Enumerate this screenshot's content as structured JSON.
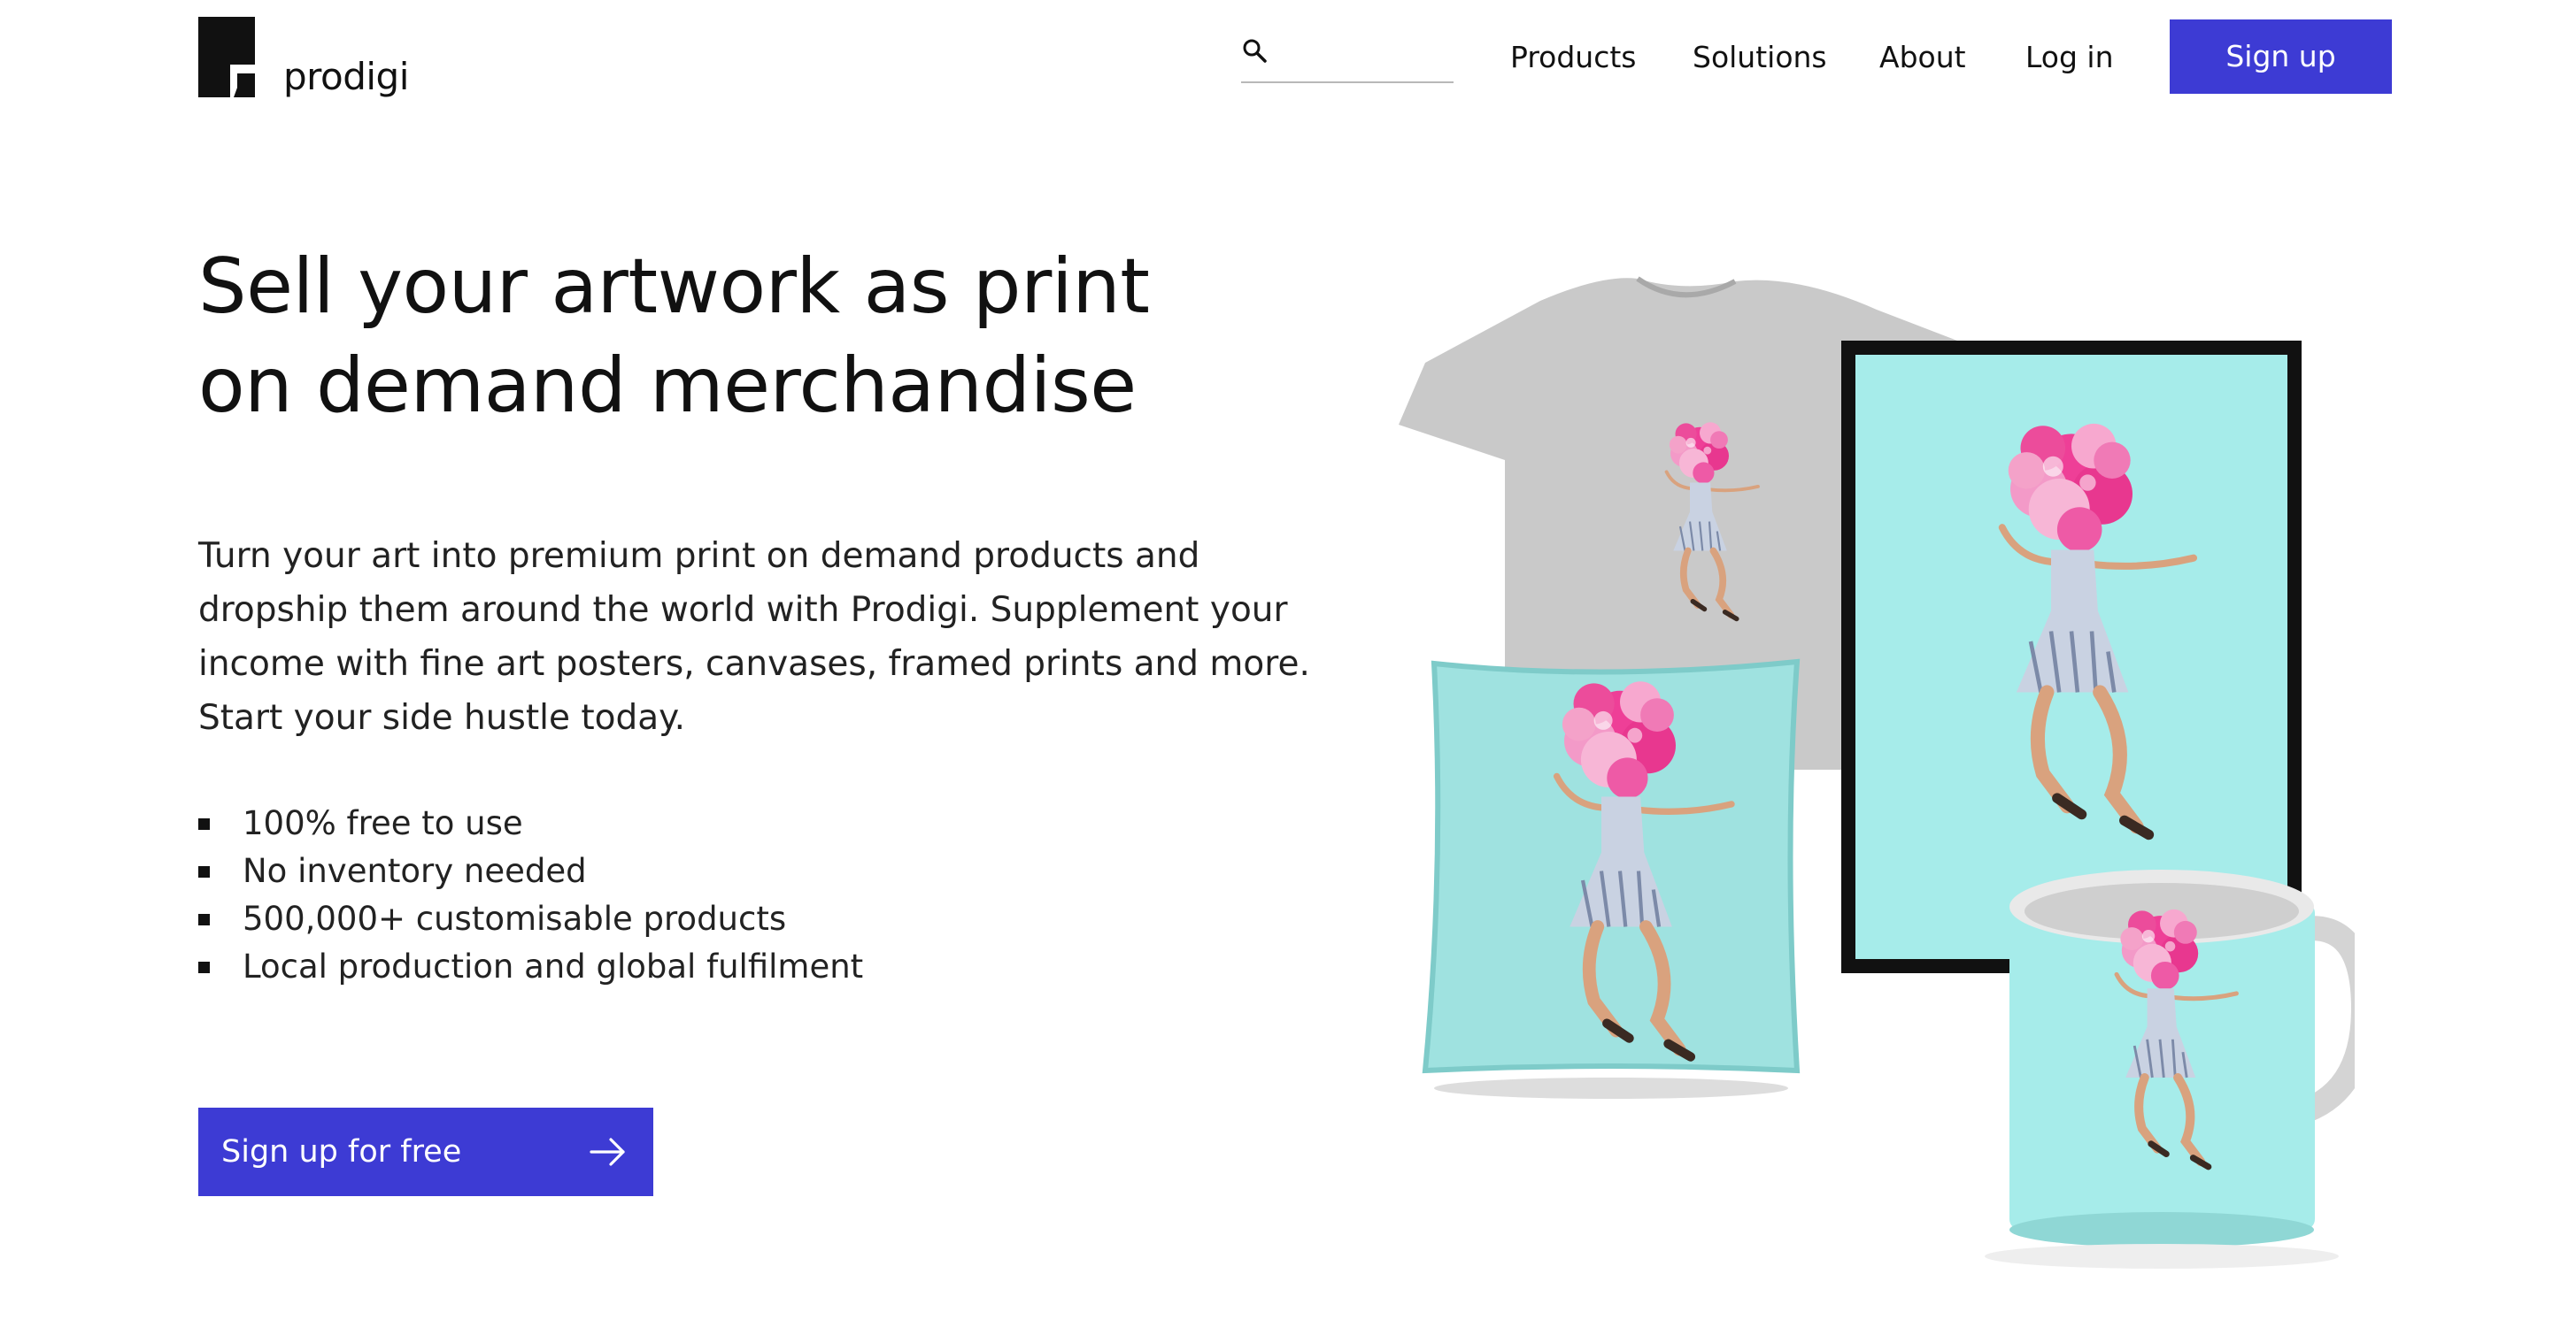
{
  "brand": {
    "name": "prodigi",
    "logo": "prodigi-logo"
  },
  "header": {
    "search": {
      "icon": "search-icon",
      "placeholder": "",
      "value": ""
    },
    "nav": {
      "products": "Products",
      "solutions": "Solutions",
      "about": "About",
      "login": "Log in"
    },
    "signup": "Sign up"
  },
  "hero": {
    "headline": [
      "Sell your artwork as print",
      "on demand merchandise"
    ],
    "intro": [
      "Turn your art into premium print on demand products and",
      "dropship them around the world with Prodigi. Supplement your",
      "income with fine art posters, canvases, framed prints and more.",
      "Start your side hustle today."
    ],
    "benefits": [
      "100% free to use",
      "No inventory needed",
      "500,000+ customisable products",
      "Local production and global fulfilment"
    ],
    "cta": {
      "label": "Sign up for free",
      "icon": "arrow-right-icon"
    }
  },
  "image": {
    "products": [
      "t-shirt",
      "framed-print",
      "cushion",
      "mug"
    ]
  },
  "colors": {
    "accent": "#3d3bd4",
    "text": "#111111",
    "product_turquoise": "#a6ecea",
    "tshirt_grey": "#c9c9c9",
    "balloon_pink": "#ee3f97"
  }
}
